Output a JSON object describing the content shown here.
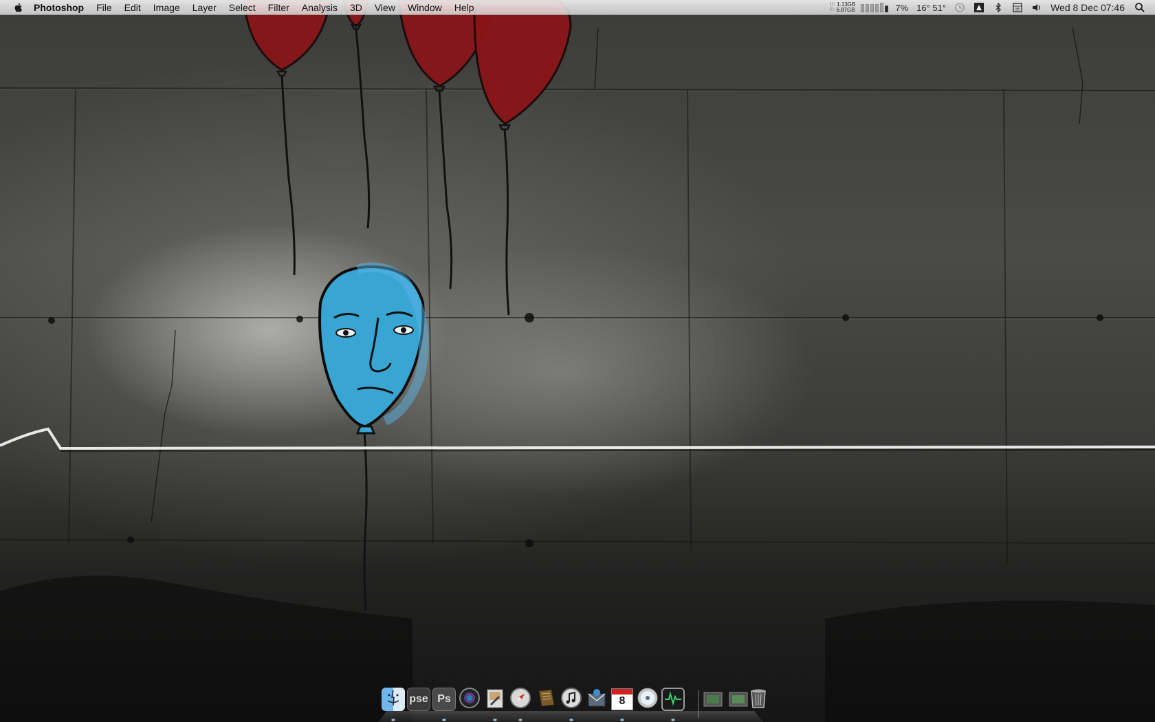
{
  "menubar": {
    "apple_icon": "apple-icon",
    "app_name": "Photoshop",
    "menus": [
      "File",
      "Edit",
      "Image",
      "Layer",
      "Select",
      "Filter",
      "Analysis",
      "3D",
      "View",
      "Window",
      "Help"
    ],
    "extras": {
      "memory": {
        "used_label": "U:",
        "used": "1.13GB",
        "free_label": "F:",
        "free": "6.87GB"
      },
      "cpu_percent": "7%",
      "temperature": "16° 51°",
      "icons": [
        "time-machine-icon",
        "adobe-icon",
        "bluetooth-icon",
        "calendar-icon",
        "volume-icon"
      ],
      "clock": "Wed 8 Dec  07:46",
      "spotlight_icon": "spotlight-icon"
    }
  },
  "dock": {
    "apps": [
      {
        "name": "Finder",
        "icon": "finder-icon",
        "label": "",
        "running": true
      },
      {
        "name": "Photoshop Elements",
        "icon": "photoshop-elements-icon",
        "label": "pse",
        "running": false
      },
      {
        "name": "Photoshop",
        "icon": "photoshop-icon",
        "label": "Ps",
        "running": true
      },
      {
        "name": "Aperture",
        "icon": "aperture-icon",
        "label": "",
        "running": false
      },
      {
        "name": "Preview",
        "icon": "preview-icon",
        "label": "",
        "running": true
      },
      {
        "name": "Safari",
        "icon": "safari-icon",
        "label": "",
        "running": true
      },
      {
        "name": "Scripts",
        "icon": "script-icon",
        "label": "",
        "running": false
      },
      {
        "name": "iTunes",
        "icon": "itunes-icon",
        "label": "",
        "running": true
      },
      {
        "name": "Mail",
        "icon": "mail-icon",
        "label": "",
        "running": false
      },
      {
        "name": "iCal",
        "icon": "calendar-icon",
        "label": "8",
        "running": true
      },
      {
        "name": "DVD Player",
        "icon": "dvd-icon",
        "label": "",
        "running": false
      },
      {
        "name": "Activity Monitor",
        "icon": "activity-monitor-icon",
        "label": "",
        "running": true
      }
    ],
    "stacks": [
      {
        "name": "Downloads",
        "icon": "folder-downloads-icon"
      },
      {
        "name": "Documents",
        "icon": "folder-documents-icon"
      }
    ],
    "trash_icon": "trash-icon"
  }
}
